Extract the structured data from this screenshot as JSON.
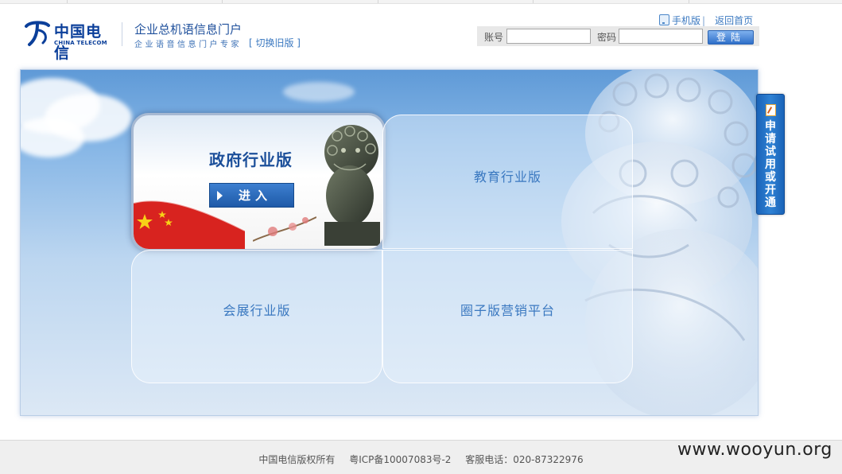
{
  "header": {
    "logo_cn": "中国电信",
    "logo_en": "CHINA TELECOM",
    "portal_title": "企业总机语信息门户",
    "portal_subtitle": "企业语音信息门户专家",
    "switch_old": "[ 切换旧版 ]",
    "mobile_link": "手机版",
    "home_link": "返回首页"
  },
  "login": {
    "account_label": "账号",
    "account_value": "",
    "password_label": "密码",
    "password_value": "",
    "submit_label": "登陆"
  },
  "panels": {
    "government": {
      "title": "政府行业版",
      "enter_label": "进入"
    },
    "education": {
      "title": "教育行业版"
    },
    "exhibition": {
      "title": "会展行业版"
    },
    "circle": {
      "title": "圈子版营销平台"
    }
  },
  "side_tab": {
    "label": "申请试用或开通"
  },
  "footer": {
    "copyright": "中国电信版权所有",
    "icp": "粤ICP备10007083号-2",
    "service": "客服电话：020-87322976"
  },
  "watermark": "www.wooyun.org",
  "colors": {
    "brand_blue": "#1e4f9b",
    "link_blue": "#3a78c0",
    "button_blue": "#1e5aa8"
  }
}
